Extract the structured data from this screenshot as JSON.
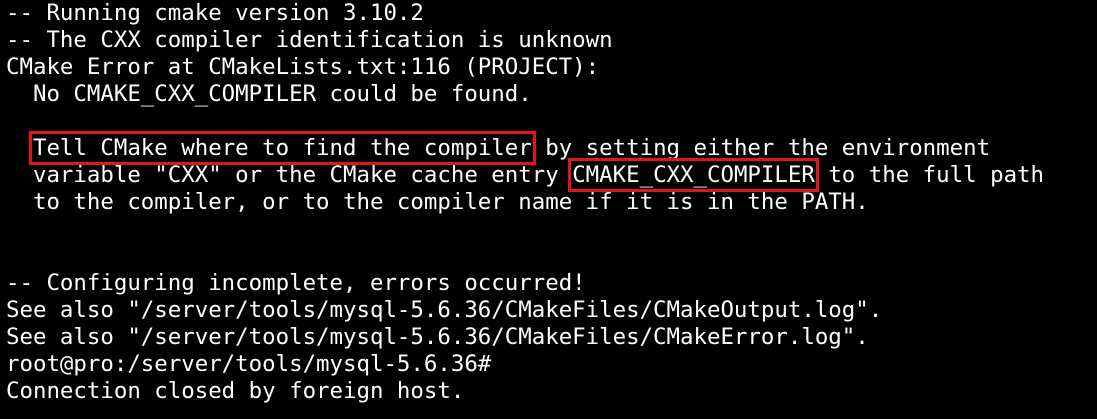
{
  "terminal": {
    "colors": {
      "background": "#000000",
      "text": "#ffffff",
      "highlight_box": "#e0161b"
    },
    "lines": {
      "l1": "-- Running cmake version 3.10.2",
      "l2": "-- The CXX compiler identification is unknown",
      "l3": "CMake Error at CMakeLists.txt:116 (PROJECT):",
      "l4": "  No CMAKE_CXX_COMPILER could be found.",
      "l6_indent": "  ",
      "l6_highlight": "Tell CMake where to find the compiler",
      "l6_rest": " by setting either the environment",
      "l7_start": "  variable \"CXX\" or the CMake cache entry ",
      "l7_highlight": "CMAKE_CXX_COMPILER",
      "l7_rest": " to the full path",
      "l8": "  to the compiler, or to the compiler name if it is in the PATH.",
      "l11": "-- Configuring incomplete, errors occurred!",
      "l12": "See also \"/server/tools/mysql-5.6.36/CMakeFiles/CMakeOutput.log\".",
      "l13": "See also \"/server/tools/mysql-5.6.36/CMakeFiles/CMakeError.log\".",
      "l14": "root@pro:/server/tools/mysql-5.6.36#",
      "l15": "Connection closed by foreign host."
    }
  }
}
